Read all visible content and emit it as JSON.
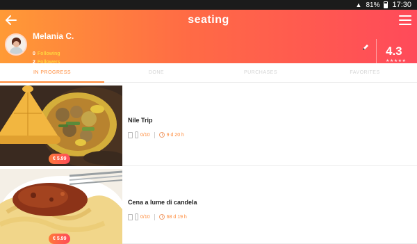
{
  "status_bar": {
    "battery": "81%",
    "time": "17:30"
  },
  "header": {
    "title": "seating",
    "user": {
      "name": "Melania C.",
      "following_count": "0",
      "following_label": "Following",
      "followers_count": "2",
      "followers_label": "Followers"
    },
    "rating": "4.3",
    "stars": "★★★★★",
    "colors": {
      "gradient_start": "#ff9a36",
      "gradient_end": "#ff4a5a",
      "accent": "#ff8a38",
      "highlight": "#ffd23f"
    }
  },
  "tabs": [
    {
      "label": "IN PROGRESS",
      "active": true
    },
    {
      "label": "DONE",
      "active": false
    },
    {
      "label": "PURCHASES",
      "active": false
    },
    {
      "label": "FAVORITES",
      "active": false
    }
  ],
  "items": [
    {
      "title": "Nile Trip",
      "price": "€ 5.99",
      "progress": "0/10",
      "duration": "9 d 20 h",
      "image": "tagine-dish"
    },
    {
      "title": "Cena a lume di candela",
      "price": "€ 5.99",
      "progress": "0/10",
      "duration": "68 d 19 h",
      "image": "pasta-dish"
    }
  ]
}
